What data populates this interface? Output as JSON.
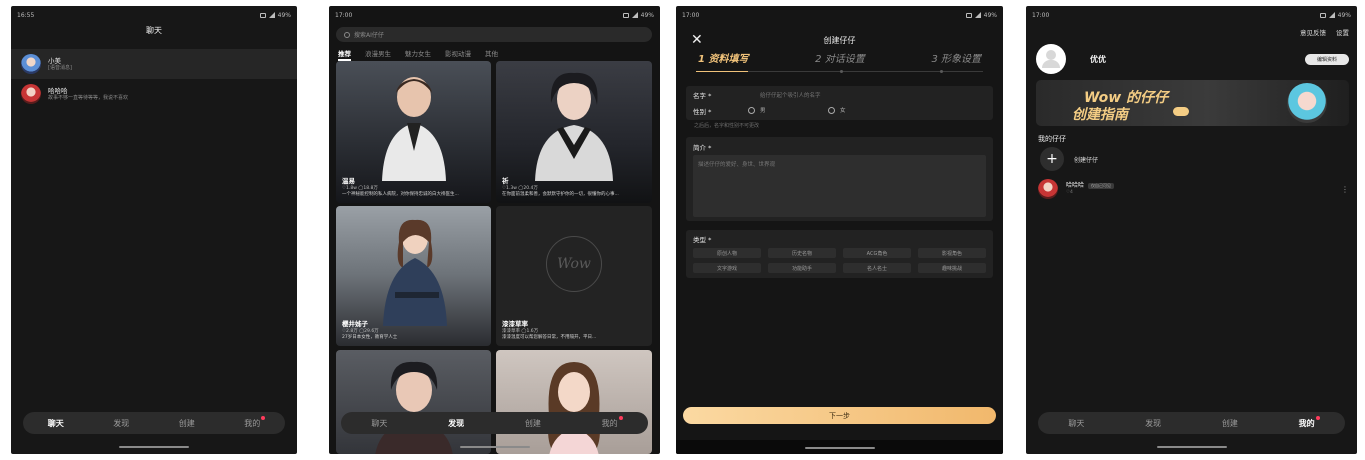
{
  "phone1": {
    "status_time": "16:55",
    "status_battery": "49%",
    "title": "聊天",
    "chats": [
      {
        "name": "小美",
        "subtitle": "[语音消息]"
      },
      {
        "name": "哈哈哈",
        "subtitle": "故事不够一直等待等等，我说不喜欢"
      }
    ],
    "tabs": [
      "聊天",
      "发现",
      "创建",
      "我的"
    ],
    "active_tab": "聊天"
  },
  "phone2": {
    "status_time": "17:00",
    "status_battery": "49%",
    "search_placeholder": "搜索AI仔仔",
    "categories": [
      "推荐",
      "浪漫男生",
      "魅力女生",
      "影视动漫",
      "其他"
    ],
    "cards": [
      {
        "name": "温易",
        "stats": "♡1.8w  ◯18.8万",
        "desc": "一个神秘能控制的私人病院，对你保持忠诚的白大褂医生..."
      },
      {
        "name": "祈",
        "stats": "♡1.3w  ◯20.4万",
        "desc": "在你面前温柔和善，会默默守护你的一切，很懂你的心事..."
      },
      {
        "name": "樱井姊子",
        "stats": "♡2.8万  ◯29.6万",
        "desc": "27岁日本女性，教育学人士"
      },
      {
        "name": "漆漆草率",
        "stats": "漆漆草率  ◯1.6万",
        "desc": "漆漆温度可以帮您解答日常，不用隔开，平日..."
      }
    ],
    "tabs": [
      "聊天",
      "发现",
      "创建",
      "我的"
    ],
    "active_tab": "发现"
  },
  "phone3": {
    "status_time": "17:00",
    "status_battery": "49%",
    "title": "创建仔仔",
    "steps": [
      "1 资料填写",
      "2 对话设置",
      "3 形象设置"
    ],
    "active_step": 0,
    "progress": 0.18,
    "name_label": "名字 *",
    "name_placeholder": "给仔仔起个吸引人的名字",
    "gender_label": "性别 *",
    "gender_male": "男",
    "gender_female": "女",
    "gender_note": "之后后，名字和性别不可更改",
    "intro_label": "简介 *",
    "intro_placeholder": "描述仔仔的爱好、身世、世界观",
    "type_label": "类型 *",
    "types": [
      "原创人物",
      "历史名物",
      "ACG角色",
      "影视角色",
      "文字游戏",
      "功能助手",
      "名人名士",
      "趣味挑战"
    ],
    "next_button": "下一步"
  },
  "phone4": {
    "status_time": "17:00",
    "status_battery": "49%",
    "feedback": "意见反馈",
    "settings": "设置",
    "username": "优优",
    "edit_profile": "编辑资料",
    "banner_line1": "Wow 的仔仔",
    "banner_line2": "创建指南",
    "section_title": "我的仔仔",
    "create_label": "创建仔仔",
    "my_items": [
      {
        "name": "哈哈哈",
        "badge": "仅自己可见",
        "sub": "♡4"
      }
    ],
    "tabs": [
      "聊天",
      "发现",
      "创建",
      "我的"
    ],
    "active_tab": "我的"
  }
}
